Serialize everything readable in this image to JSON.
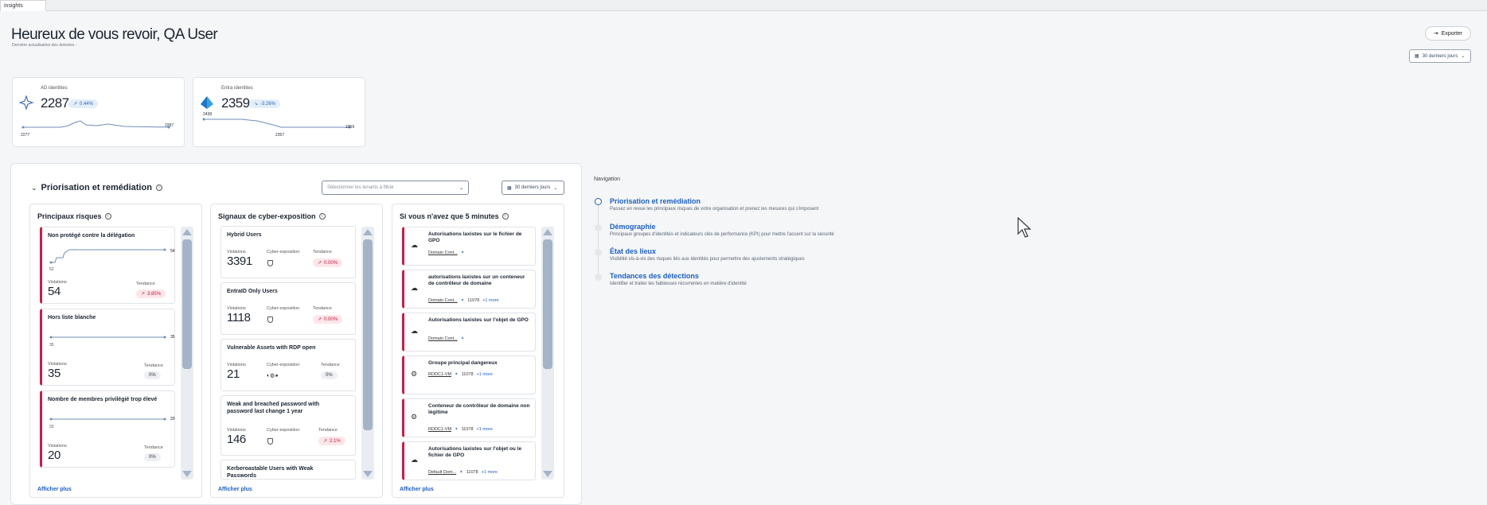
{
  "tab": {
    "label": "insights"
  },
  "header": {
    "greeting": "Heureux de vous revoir, QA User",
    "subtitle": "Dernière actualisation des données -",
    "export_label": "Exporter",
    "period_label": "30 derniers jours"
  },
  "kpis": [
    {
      "label": "AD identities",
      "value": "2287",
      "trend": "0.44%",
      "trend_dir": "up",
      "start": "2277",
      "end": "2287"
    },
    {
      "label": "Entra identities",
      "value": "2359",
      "trend": "-3.26%",
      "trend_dir": "down",
      "start": "2438",
      "min": "2357",
      "end": "2359"
    }
  ],
  "panel": {
    "title": "Priorisation et remédiation",
    "tenant_placeholder": "Sélectionner les tenants à filtrer",
    "period_label": "30 derniers jours",
    "show_more": "Afficher plus",
    "violations_label": "Violations",
    "trend_label": "Tendance",
    "cyber_label": "Cyber-exposition"
  },
  "risks": {
    "title": "Principaux risques",
    "items": [
      {
        "title": "Non protégé contre la délégation",
        "violations": "54",
        "trend": "3.85%",
        "trend_color": "red",
        "start": "52",
        "end": "54"
      },
      {
        "title": "Hors liste blanche",
        "violations": "35",
        "trend": "0%",
        "trend_color": "grey",
        "start": "35",
        "end": "35"
      },
      {
        "title": "Nombre de membres privilégié trop élevé",
        "violations": "20",
        "trend": "0%",
        "trend_color": "grey",
        "start": "20",
        "end": "20"
      }
    ]
  },
  "signals": {
    "title": "Signaux de cyber-exposition",
    "items": [
      {
        "title": "Hybrid Users",
        "violations": "3391",
        "trend": "0.00%",
        "trend_color": "red"
      },
      {
        "title": "EntraID Only Users",
        "violations": "1118",
        "trend": "0.00%",
        "trend_color": "red"
      },
      {
        "title": "Vulnerable Assets with RDP open",
        "violations": "21",
        "trend": "0%",
        "trend_color": "grey"
      },
      {
        "title": "Weak and breached password with password last change 1 year",
        "violations": "146",
        "trend": "2.1%",
        "trend_color": "red"
      },
      {
        "title": "Kerberoastable Users with Weak Passwords",
        "violations": "",
        "trend": "",
        "trend_color": "grey"
      }
    ]
  },
  "five_min": {
    "title": "Si vous n'avez que 5 minutes",
    "items": [
      {
        "title": "Autorisations laxistes sur le fichier de GPO",
        "tag": "Domain Cont...",
        "extra": "",
        "more": "",
        "icon": "cloud-icon"
      },
      {
        "title": "autorisations laxistes sur un conteneur de contrôleur de domaine",
        "tag": "Domain Cont...",
        "extra": "11078",
        "more": "+1 more",
        "icon": "cloud-icon"
      },
      {
        "title": "Autorisations laxistes sur l'objet de GPO",
        "tag": "Domain Cont...",
        "extra": "",
        "more": "",
        "icon": "cloud-icon"
      },
      {
        "title": "Groupe principal dangereux",
        "tag": "RDDC1-VM",
        "extra": "11078",
        "more": "+1 more",
        "icon": "user-gear-icon"
      },
      {
        "title": "Conteneur de contrôleur de domaine non légitime",
        "tag": "RDDC1-VM",
        "extra": "11078",
        "more": "+1 more",
        "icon": "user-gear-icon"
      },
      {
        "title": "Autorisations laxistes sur l'objet ou le fichier de GPO",
        "tag": "Default Dom...",
        "extra": "11078",
        "more": "+1 more",
        "icon": "cloud-icon"
      }
    ]
  },
  "navigation": {
    "label": "Navigation",
    "items": [
      {
        "title": "Priorisation et remédiation",
        "desc": "Passez en revue les principaux risques de votre organisation et prenez les mesures qui s'imposent",
        "active": true
      },
      {
        "title": "Démographie",
        "desc": "Principaux groupes d'identités et indicateurs clés de performance (KPI) pour mettre l'accent sur la sécurité",
        "active": false
      },
      {
        "title": "État des lieux",
        "desc": "Visibilité vis-à-vis des risques liés aux identités pour permettre des ajustements stratégiques",
        "active": false
      },
      {
        "title": "Tendances des détections",
        "desc": "Identifier et traiter les faiblesses récurrentes en matière d'identité",
        "active": false
      }
    ]
  },
  "colors": {
    "accent": "#1c5ec7",
    "danger": "#d01a45",
    "text": "#1b2432",
    "bg": "#f4f6f7"
  }
}
